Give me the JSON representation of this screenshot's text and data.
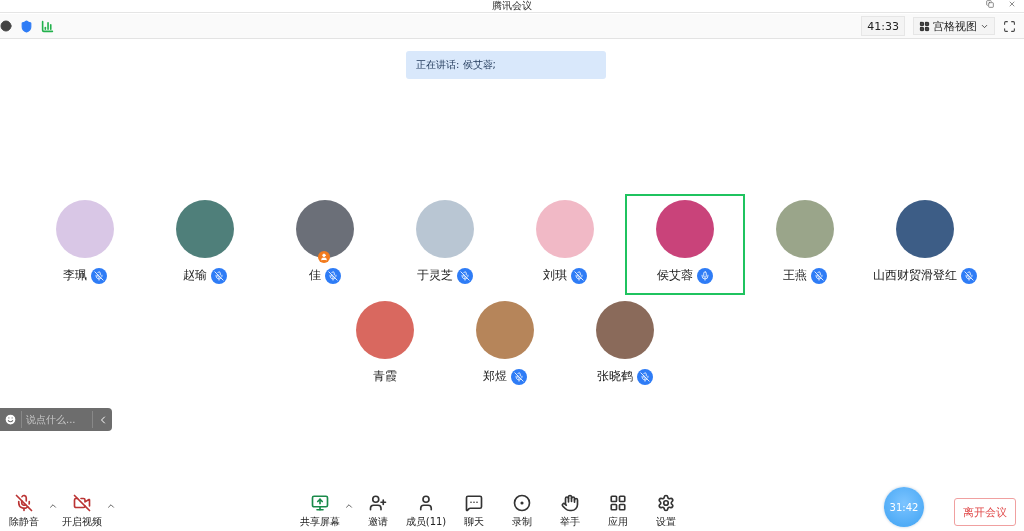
{
  "window": {
    "title": "腾讯会议"
  },
  "toolbar": {
    "timer": "41:33",
    "view_button": "宫格视图"
  },
  "speaker_banner": "正在讲话: 侯艾蓉;",
  "participants": [
    {
      "name": "李珮",
      "kind": "muted",
      "speaking": false,
      "host": false,
      "color": "#d9c7e6"
    },
    {
      "name": "赵瑜",
      "kind": "muted",
      "speaking": false,
      "host": false,
      "color": "#4f7f7a"
    },
    {
      "name": "佳",
      "kind": "muted",
      "speaking": false,
      "host": true,
      "color": "#6b6f78"
    },
    {
      "name": "于灵芝",
      "kind": "muted",
      "speaking": false,
      "host": false,
      "color": "#b9c6d3"
    },
    {
      "name": "刘琪",
      "kind": "muted",
      "speaking": false,
      "host": false,
      "color": "#f1b9c6"
    },
    {
      "name": "侯艾蓉",
      "kind": "talking",
      "speaking": true,
      "host": false,
      "color": "#c9437a"
    },
    {
      "name": "王燕",
      "kind": "muted",
      "speaking": false,
      "host": false,
      "color": "#9aa58a"
    },
    {
      "name": "山西财贸滑登红",
      "kind": "muted",
      "speaking": false,
      "host": false,
      "color": "#3d5d86"
    },
    {
      "name": "青霞",
      "kind": "no-mic",
      "speaking": false,
      "host": false,
      "color": "#d9685f"
    },
    {
      "name": "郑煜",
      "kind": "muted",
      "speaking": false,
      "host": false,
      "color": "#b6855a"
    },
    {
      "name": "张晓鹤",
      "kind": "muted",
      "speaking": false,
      "host": false,
      "color": "#8a6a5a"
    }
  ],
  "chat_input": {
    "placeholder": "说点什么..."
  },
  "bottom_left": [
    {
      "label": "除静音",
      "kind": "mic-off",
      "menu": true
    },
    {
      "label": "开启视频",
      "kind": "video-off",
      "menu": true
    }
  ],
  "bottom_center": [
    {
      "label": "共享屏幕",
      "kind": "share",
      "menu": true
    },
    {
      "label": "邀请",
      "kind": "invite",
      "menu": false
    },
    {
      "label": "成员(11)",
      "kind": "members",
      "menu": false
    },
    {
      "label": "聊天",
      "kind": "chat",
      "menu": false
    },
    {
      "label": "录制",
      "kind": "record",
      "menu": false
    },
    {
      "label": "举手",
      "kind": "hand",
      "menu": false
    },
    {
      "label": "应用",
      "kind": "apps",
      "menu": false
    },
    {
      "label": "设置",
      "kind": "settings",
      "menu": false
    }
  ],
  "meeting_timer": "31:42",
  "leave_button": "离开会议"
}
